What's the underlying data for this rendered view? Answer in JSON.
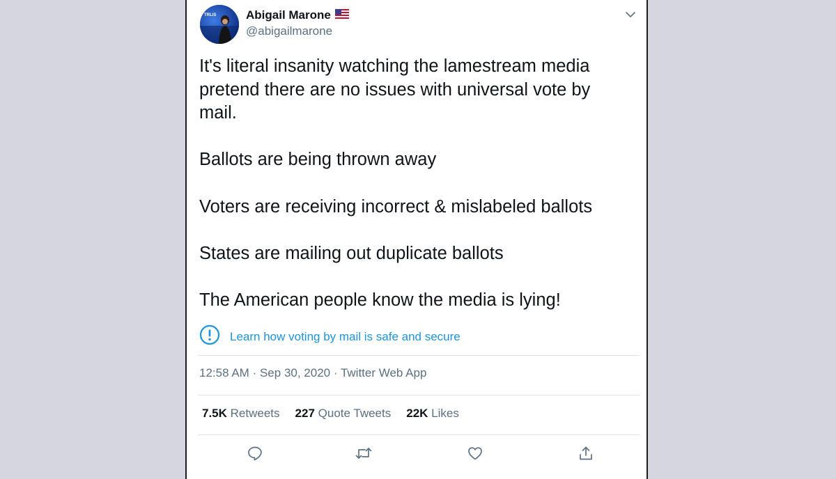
{
  "tweet": {
    "display_name": "Abigail Marone",
    "flag_icon": "us-flag-icon",
    "handle": "@abigailmarone",
    "avatar_text": "TRLIS",
    "paragraphs": [
      "It's literal insanity watching the lamestream media pretend there are no issues with universal vote by mail.",
      "Ballots are being thrown away",
      "Voters are receiving incorrect & mislabeled ballots",
      "States are mailing out duplicate ballots",
      "The American people know the media is lying!"
    ],
    "notice": {
      "icon": "info-exclamation-icon",
      "label": "Learn how voting by mail is safe and secure"
    },
    "time": "12:58 AM",
    "date": "Sep 30, 2020",
    "source": "Twitter Web App",
    "separator": "·",
    "stats": {
      "retweets_count": "7.5K",
      "retweets_label": "Retweets",
      "quotes_count": "227",
      "quotes_label": "Quote Tweets",
      "likes_count": "22K",
      "likes_label": "Likes"
    },
    "actions": [
      "reply-icon",
      "retweet-icon",
      "like-icon",
      "share-icon"
    ]
  },
  "colors": {
    "background": "#d6d6e0",
    "card": "#ffffff",
    "text": "#0f1419",
    "muted": "#5b7083",
    "link": "#1b95e0",
    "divider": "#dfe3e7"
  }
}
